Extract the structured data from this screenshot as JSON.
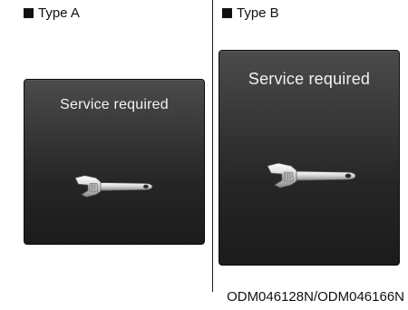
{
  "type_a": {
    "label": "Type A",
    "panel_title": "Service required",
    "icon": "wrench-icon"
  },
  "type_b": {
    "label": "Type B",
    "panel_title": "Service required",
    "icon": "wrench-icon"
  },
  "figure_code": "ODM046128N/ODM046166N",
  "colors": {
    "panel_background": "#2a2a2a",
    "panel_text": "#f2f2f2",
    "page_text": "#111111"
  }
}
